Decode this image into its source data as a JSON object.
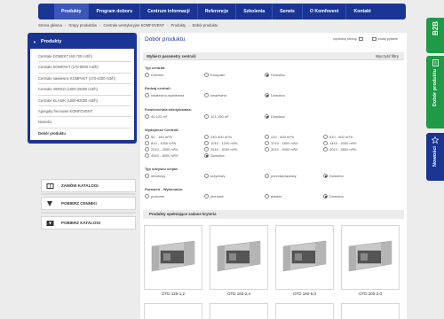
{
  "colors": {
    "brand": "#1a3494",
    "green": "#1f9a46",
    "background": "#ececec"
  },
  "nav": {
    "items": [
      "Produkty",
      "Program doboru",
      "Centrum informacji",
      "Referencje",
      "Szkolenia",
      "Serwis",
      "O Komfovent",
      "Kontakt"
    ],
    "active": "Produkty"
  },
  "breadcrumb": [
    "Strona główna",
    "Grupy produktów",
    "Centrale wentylacyjne KOMFOVENT",
    "Produkty",
    "Dobór produktu"
  ],
  "side_tabs": {
    "b2b": "B2B",
    "dobor": "Dobór produktu",
    "nowosci": "Nowości"
  },
  "sidebar": {
    "title": "Produkty",
    "items": [
      "Centrale DOMEKT (60-720 m3/h)",
      "Centrale KOMPAKT (170-8000 m3/h)",
      "Centrale nawiewne KOMPAKT (170-4200 m3/h)",
      "Centrale VERSO (1000-26000 m3/h)",
      "Centrale KLASIK (1000-82000 m3/h)",
      "Agregaty freonowe KOMFOVENT",
      "Nowości",
      "Dobór produktu"
    ]
  },
  "actions": {
    "katalog": "ZAMÓW KATALOGI",
    "cennik": "POBIERZ CENNIKI",
    "pobierz_katalog": "POBIERZ KATALOGI"
  },
  "main": {
    "title": "Dobór produktu",
    "tool_print": "wydrukuj stronę",
    "tool_ask": "zadaj pytanie",
    "filter_title": "Wybierz parametry centrali:",
    "reset": "Wyczyść filtry",
    "groups": {
      "typ": {
        "label": "Typ centrali:",
        "options": [
          "Domekt",
          "Kompakt",
          "Dowolna"
        ]
      },
      "rodzaj": {
        "label": "Rodzaj centrali:",
        "options": [
          "nawiewno-wywiewna",
          "nawiewna",
          "Dowolna"
        ]
      },
      "powierzchnia": {
        "label": "Powierzchnia wentylowana:",
        "options": [
          "40-120 m²",
          "121-190 m²",
          "Dowolna"
        ]
      },
      "wydajnosc": {
        "label": "Wydajność Centrali:",
        "options": [
          "50 - 150 m³/h",
          "240-400 m³/h",
          "410 - 600 m³/h",
          "610 - 800 m³/h",
          "810 - 1000 m³/h",
          "1010 - 1200 m³/h",
          "1210 - 1600 m³/h",
          "1410 - 2000 m³/h",
          "2010 - 2500 m³/h",
          "2510 - 3000 m³/h",
          "3010 - 4000 m³/h",
          "4010 - 4500 m³/h",
          "4510 - 8000 m³/h",
          "Dowolna"
        ]
      },
      "odzysk": {
        "label": "Typ odzysku ciepła:",
        "options": [
          "obrotowy",
          "krzyżowy",
          "przeciwprądowy",
          "Dowolna"
        ]
      },
      "wykonanie": {
        "label": "Parametr - Wykonanie:",
        "options": [
          "poziome",
          "pionowe",
          "płaskie",
          "Dowolna"
        ]
      }
    },
    "products_title": "Produkty spełniające zadane kryteria",
    "products": [
      "OTD 125-1,2",
      "OTD 160-2,4",
      "OTD 160-5,0",
      "OTD 200-2,0"
    ]
  }
}
